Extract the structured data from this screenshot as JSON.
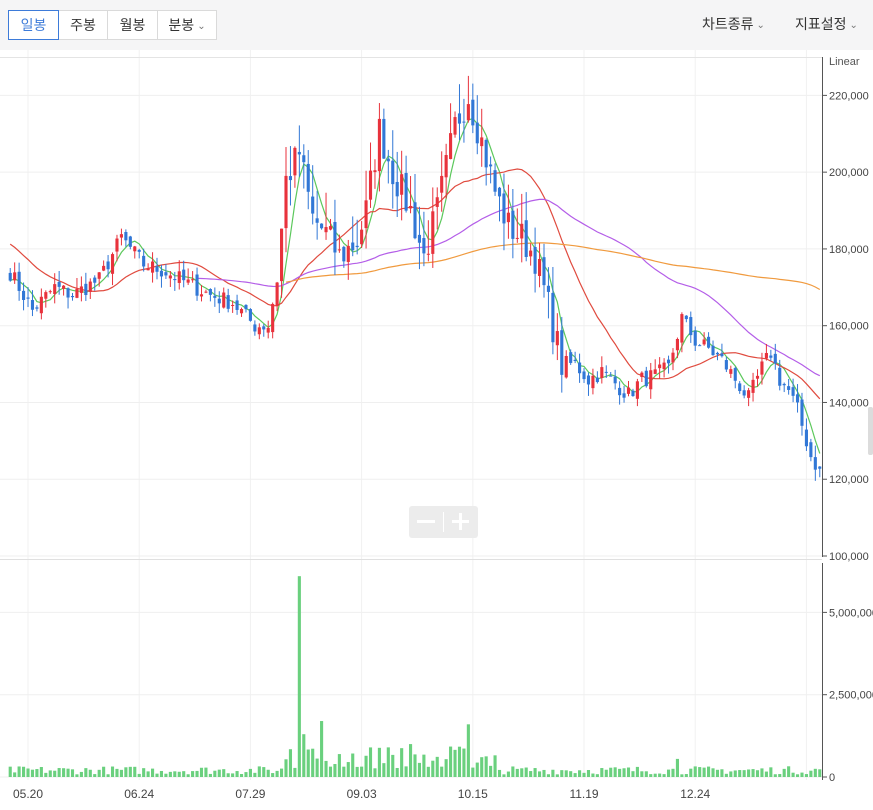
{
  "toolbar": {
    "tabs": [
      {
        "label": "일봉",
        "active": true
      },
      {
        "label": "주봉",
        "active": false
      },
      {
        "label": "월봉",
        "active": false
      },
      {
        "label": "분봉",
        "active": false,
        "dropdown": true
      }
    ],
    "chart_type_label": "차트종류",
    "indicator_label": "지표설정"
  },
  "colors": {
    "up": "#e8323c",
    "down": "#3177d6",
    "ma5": "#5cc85c",
    "ma20": "#e04b3f",
    "ma60": "#b45ee8",
    "ma120": "#f09a3e",
    "volume": "#6ad07e",
    "accent": "#3d7bd9"
  },
  "chart_data": [
    {
      "type": "candlestick",
      "scale_label": "Linear",
      "y_ticks": [
        "100,000",
        "120,000",
        "140,000",
        "160,000",
        "180,000",
        "200,000",
        "220,000"
      ],
      "ylim": [
        100000,
        230000
      ],
      "x_tick_labels": [
        "05.20",
        "06.24",
        "07.29",
        "09.03",
        "10.15",
        "11.19",
        "12.24"
      ],
      "moving_averages": [
        "ma5",
        "ma20",
        "ma60",
        "ma120"
      ],
      "series_close_approx": [
        [
          0,
          174000
        ],
        [
          5,
          164000
        ],
        [
          10,
          170000
        ],
        [
          14,
          168000
        ],
        [
          20,
          172000
        ],
        [
          25,
          183000
        ],
        [
          30,
          176000
        ],
        [
          35,
          174000
        ],
        [
          40,
          171000
        ],
        [
          45,
          168000
        ],
        [
          50,
          166000
        ],
        [
          55,
          160000
        ],
        [
          58,
          160000
        ],
        [
          60,
          172000
        ],
        [
          62,
          198000
        ],
        [
          65,
          205000
        ],
        [
          68,
          188000
        ],
        [
          71,
          184000
        ],
        [
          74,
          178000
        ],
        [
          78,
          182000
        ],
        [
          80,
          190000
        ],
        [
          83,
          211000
        ],
        [
          86,
          200000
        ],
        [
          90,
          190000
        ],
        [
          93,
          178000
        ],
        [
          96,
          190000
        ],
        [
          100,
          212000
        ],
        [
          103,
          220000
        ],
        [
          106,
          208000
        ],
        [
          109,
          195000
        ],
        [
          112,
          186000
        ],
        [
          115,
          183000
        ],
        [
          118,
          178000
        ],
        [
          121,
          165000
        ],
        [
          124,
          150000
        ],
        [
          127,
          150000
        ],
        [
          130,
          146000
        ],
        [
          133,
          148000
        ],
        [
          136,
          145000
        ],
        [
          139,
          142000
        ],
        [
          142,
          146000
        ],
        [
          145,
          147000
        ],
        [
          148,
          149000
        ],
        [
          151,
          162000
        ],
        [
          154,
          156000
        ],
        [
          157,
          154000
        ],
        [
          160,
          151000
        ],
        [
          163,
          146000
        ],
        [
          166,
          141000
        ],
        [
          169,
          149000
        ],
        [
          171,
          153000
        ],
        [
          173,
          146000
        ],
        [
          175,
          143000
        ],
        [
          177,
          138000
        ],
        [
          180,
          126000
        ],
        [
          182,
          122000
        ]
      ]
    },
    {
      "type": "bar",
      "name": "volume",
      "y_ticks": [
        "0",
        "2,500,000",
        "5,000,000"
      ],
      "ylim": [
        0,
        6500000
      ],
      "spikes_approx": [
        {
          "x": 65,
          "value": 6100000
        },
        {
          "x": 66,
          "value": 1300000
        },
        {
          "x": 70,
          "value": 1700000
        },
        {
          "x": 85,
          "value": 900000
        },
        {
          "x": 90,
          "value": 1000000
        },
        {
          "x": 103,
          "value": 1600000
        },
        {
          "x": 150,
          "value": 550000
        }
      ]
    }
  ]
}
